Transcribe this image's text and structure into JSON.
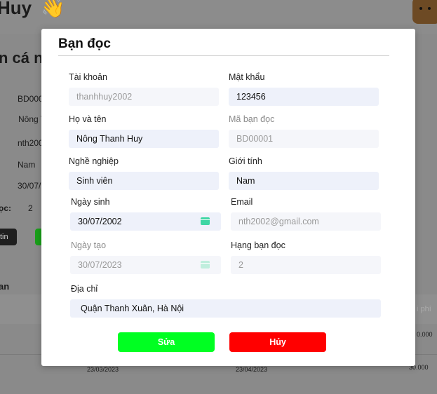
{
  "background": {
    "greeting": "Huy",
    "wave_emoji": "👋",
    "section_title": "n cá n",
    "values": [
      "BD000",
      "Nông T",
      "nth200",
      "Nam",
      "30/07/"
    ],
    "label_tier": "ọc:",
    "tier_value": "2",
    "button_dark": "tin",
    "history_title": "an",
    "column_fee": "i phí",
    "rows": [
      {
        "date_from": "",
        "date_to": "",
        "fee": "0.000"
      },
      {
        "date_from": "23/03/2023",
        "date_to": "23/04/2023",
        "fee": "30.000"
      }
    ]
  },
  "modal": {
    "title": "Bạn đọc",
    "fields": {
      "account": {
        "label": "Tài khoản",
        "value": "thanhhuy2002"
      },
      "password": {
        "label": "Mật khẩu",
        "value": "123456"
      },
      "full_name": {
        "label": "Họ và tên",
        "value": "Nông Thanh Huy"
      },
      "reader_id": {
        "label": "Mã bạn đọc",
        "value": "BD00001"
      },
      "occupation": {
        "label": "Nghề nghiệp",
        "value": "Sinh viên"
      },
      "gender": {
        "label": "Giới tính",
        "value": "Nam"
      },
      "birthday": {
        "label": "Ngày sinh",
        "value": "30/07/2002"
      },
      "email": {
        "label": "Email",
        "value": "nth2002@gmail.com"
      },
      "created_date": {
        "label": "Ngày tạo",
        "value": "30/07/2023"
      },
      "reader_rank": {
        "label": "Hạng bạn đọc",
        "value": "2"
      },
      "address": {
        "label": "Địa chỉ",
        "value": "Quận Thanh Xuân, Hà Nội"
      }
    },
    "buttons": {
      "edit": "Sửa",
      "cancel": "Hủy"
    }
  },
  "colors": {
    "edit_button": "#00ff22",
    "cancel_button": "#ff0000",
    "field_bg": "#eef1fa",
    "calendar_icon": "#3ed6a4"
  }
}
